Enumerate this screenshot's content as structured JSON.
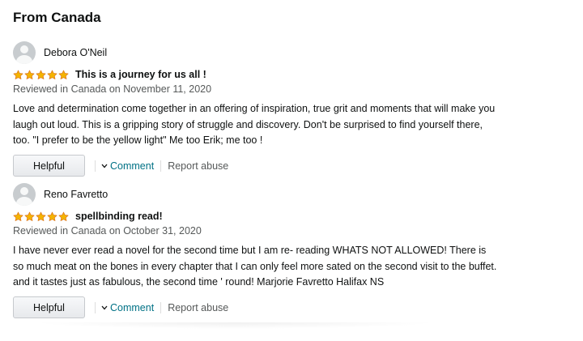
{
  "section": {
    "title": "From Canada"
  },
  "colors": {
    "star": "#f4b400",
    "link": "#007185",
    "muted": "#565959"
  },
  "reviews": [
    {
      "author": "Debora O'Neil",
      "rating": 5,
      "title": "This is a journey for us all !",
      "date": "Reviewed in Canada on November 11, 2020",
      "body": "Love and determination come together in an offering of inspiration, true grit and moments that will make you laugh out loud. This is a gripping story of struggle and discovery. Don't be surprised to find yourself there, too. \"I prefer to be the yellow light\" Me too Erik; me too !",
      "helpful_label": "Helpful",
      "comment_label": "Comment",
      "report_label": "Report abuse"
    },
    {
      "author": "Reno Favretto",
      "rating": 5,
      "title": "spellbinding read!",
      "date": "Reviewed in Canada on October 31, 2020",
      "body": "I have never ever read a novel for the second time but I am re- reading WHATS NOT ALLOWED! There is so much meat on the bones in every chapter that I can only feel more sated on the second visit to the buffet. and it tastes just as fabulous, the second time ' round! Marjorie Favretto Halifax NS",
      "helpful_label": "Helpful",
      "comment_label": "Comment",
      "report_label": "Report abuse"
    }
  ]
}
